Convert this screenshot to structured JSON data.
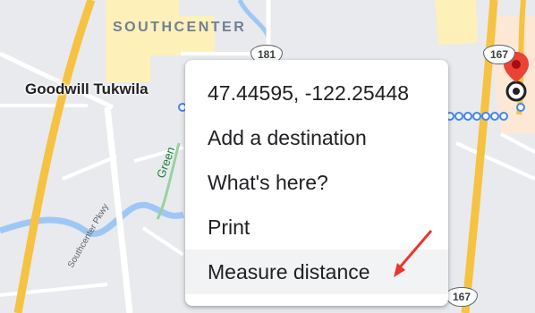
{
  "map": {
    "district_label": "SOUTHCENTER",
    "poi_label": "Goodwill Tukwila",
    "route_shields": {
      "hwy_181": "181",
      "hwy_167_top": "167",
      "hwy_167_bottom": "167"
    },
    "green_trail_label": "Green",
    "parkway_label": "Southcenter Pkwy"
  },
  "context_menu": {
    "items": [
      {
        "label": "47.44595, -122.25448"
      },
      {
        "label": "Add a destination"
      },
      {
        "label": "What's here?"
      },
      {
        "label": "Print"
      },
      {
        "label": "Measure distance"
      }
    ]
  },
  "colors": {
    "menu_background": "#ffffff",
    "hovered_item_background": "#f1f3f4",
    "annotation_arrow": "#e8372c",
    "pin": "#ea4335",
    "route_dots": "#4285f4",
    "highway": "#f6c242"
  }
}
